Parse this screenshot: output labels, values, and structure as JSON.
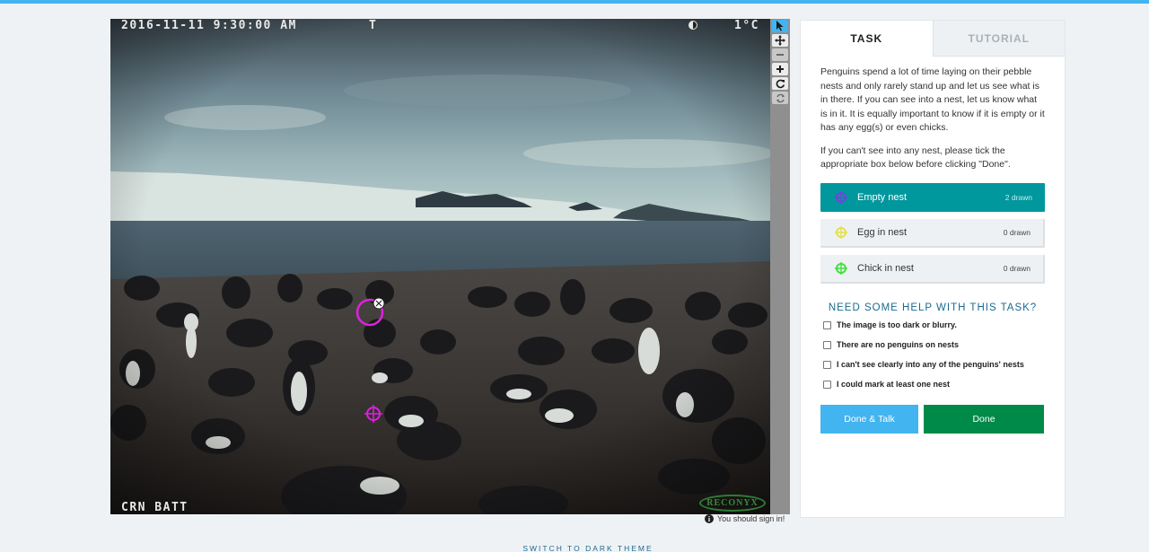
{
  "camera": {
    "timestamp": "2016-11-11 9:30:00 AM",
    "marker": "T",
    "temperature": "1°C",
    "battery_label": "CRN BATT",
    "brand": "RECONYX"
  },
  "toolbar": {
    "tools": [
      "pointer",
      "pan",
      "zoom-out",
      "zoom-in",
      "rotate",
      "reset"
    ]
  },
  "sign_in_notice": "You should sign in!",
  "tabs": [
    {
      "label": "TASK",
      "active": true
    },
    {
      "label": "TUTORIAL",
      "active": false
    }
  ],
  "instructions": [
    "Penguins spend a lot of time laying on their pebble nests and only rarely stand up and let us see what is in there. If you can see into a nest, let us know what is in it. It is equally important to know if it is empty or it has any egg(s) or even chicks.",
    "If you can't see into any nest, please tick the appropriate box below before clicking \"Done\"."
  ],
  "marking_tools": [
    {
      "label": "Empty nest",
      "count": "2 drawn",
      "color": "#7b3fe0",
      "selected": true
    },
    {
      "label": "Egg in nest",
      "count": "0 drawn",
      "color": "#e5e04a",
      "selected": false
    },
    {
      "label": "Chick in nest",
      "count": "0 drawn",
      "color": "#41e03f",
      "selected": false
    }
  ],
  "help": {
    "heading": "NEED SOME HELP WITH THIS TASK?",
    "options": [
      "The image is too dark or blurry.",
      "There are no penguins on nests",
      "I can't see clearly into any of the penguins' nests",
      "I could mark at least one nest"
    ]
  },
  "buttons": {
    "done_talk": "Done & Talk",
    "done": "Done"
  },
  "footer": {
    "theme_link": "SWITCH TO DARK THEME"
  },
  "colors": {
    "accent_blue": "#42b4ef",
    "selected_tool": "#00979d",
    "done_green": "#008a4a",
    "annotation_magenta": "#e020e0"
  }
}
